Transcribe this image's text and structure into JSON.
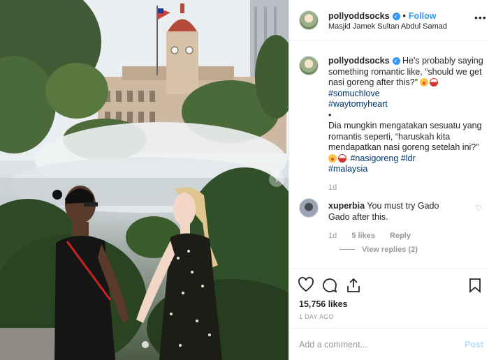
{
  "header": {
    "username": "pollyoddsocks",
    "separator": "•",
    "follow_label": "Follow",
    "location": "Masjid Jamek Sultan Abdul Samad",
    "more_icon": "more-horizontal-icon"
  },
  "caption": {
    "username": "pollyoddsocks",
    "text_en": "He's probably saying something romantic like, “should we get nasi goreng after this?”",
    "tags_en": [
      "#somuchlove",
      "#waytomyheart"
    ],
    "bullet": "•",
    "text_ms": "Dia mungkin mengatakan sesuatu yang romantis seperti, “haruskah kita mendapatkan nasi goreng setelah ini?”",
    "tags_ms": [
      "#nasigoreng",
      "#ldr",
      "#malaysia"
    ],
    "time": "1d"
  },
  "comment": {
    "username": "xuperbia",
    "text": "You must try Gado Gado after this.",
    "time": "1d",
    "likes": "5 likes",
    "reply_label": "Reply",
    "view_replies": "View replies (2)"
  },
  "actions": {
    "like_icon": "heart-icon",
    "comment_icon": "comment-icon",
    "share_icon": "share-icon",
    "save_icon": "bookmark-icon",
    "likes_count": "15,756 likes",
    "posted_ago": "1 DAY AGO"
  },
  "add_comment": {
    "placeholder": "Add a comment...",
    "post_label": "Post"
  },
  "colors": {
    "link": "#3897f0",
    "hashtag": "#003569",
    "muted": "#999999",
    "post_disabled": "#b2dffc"
  }
}
